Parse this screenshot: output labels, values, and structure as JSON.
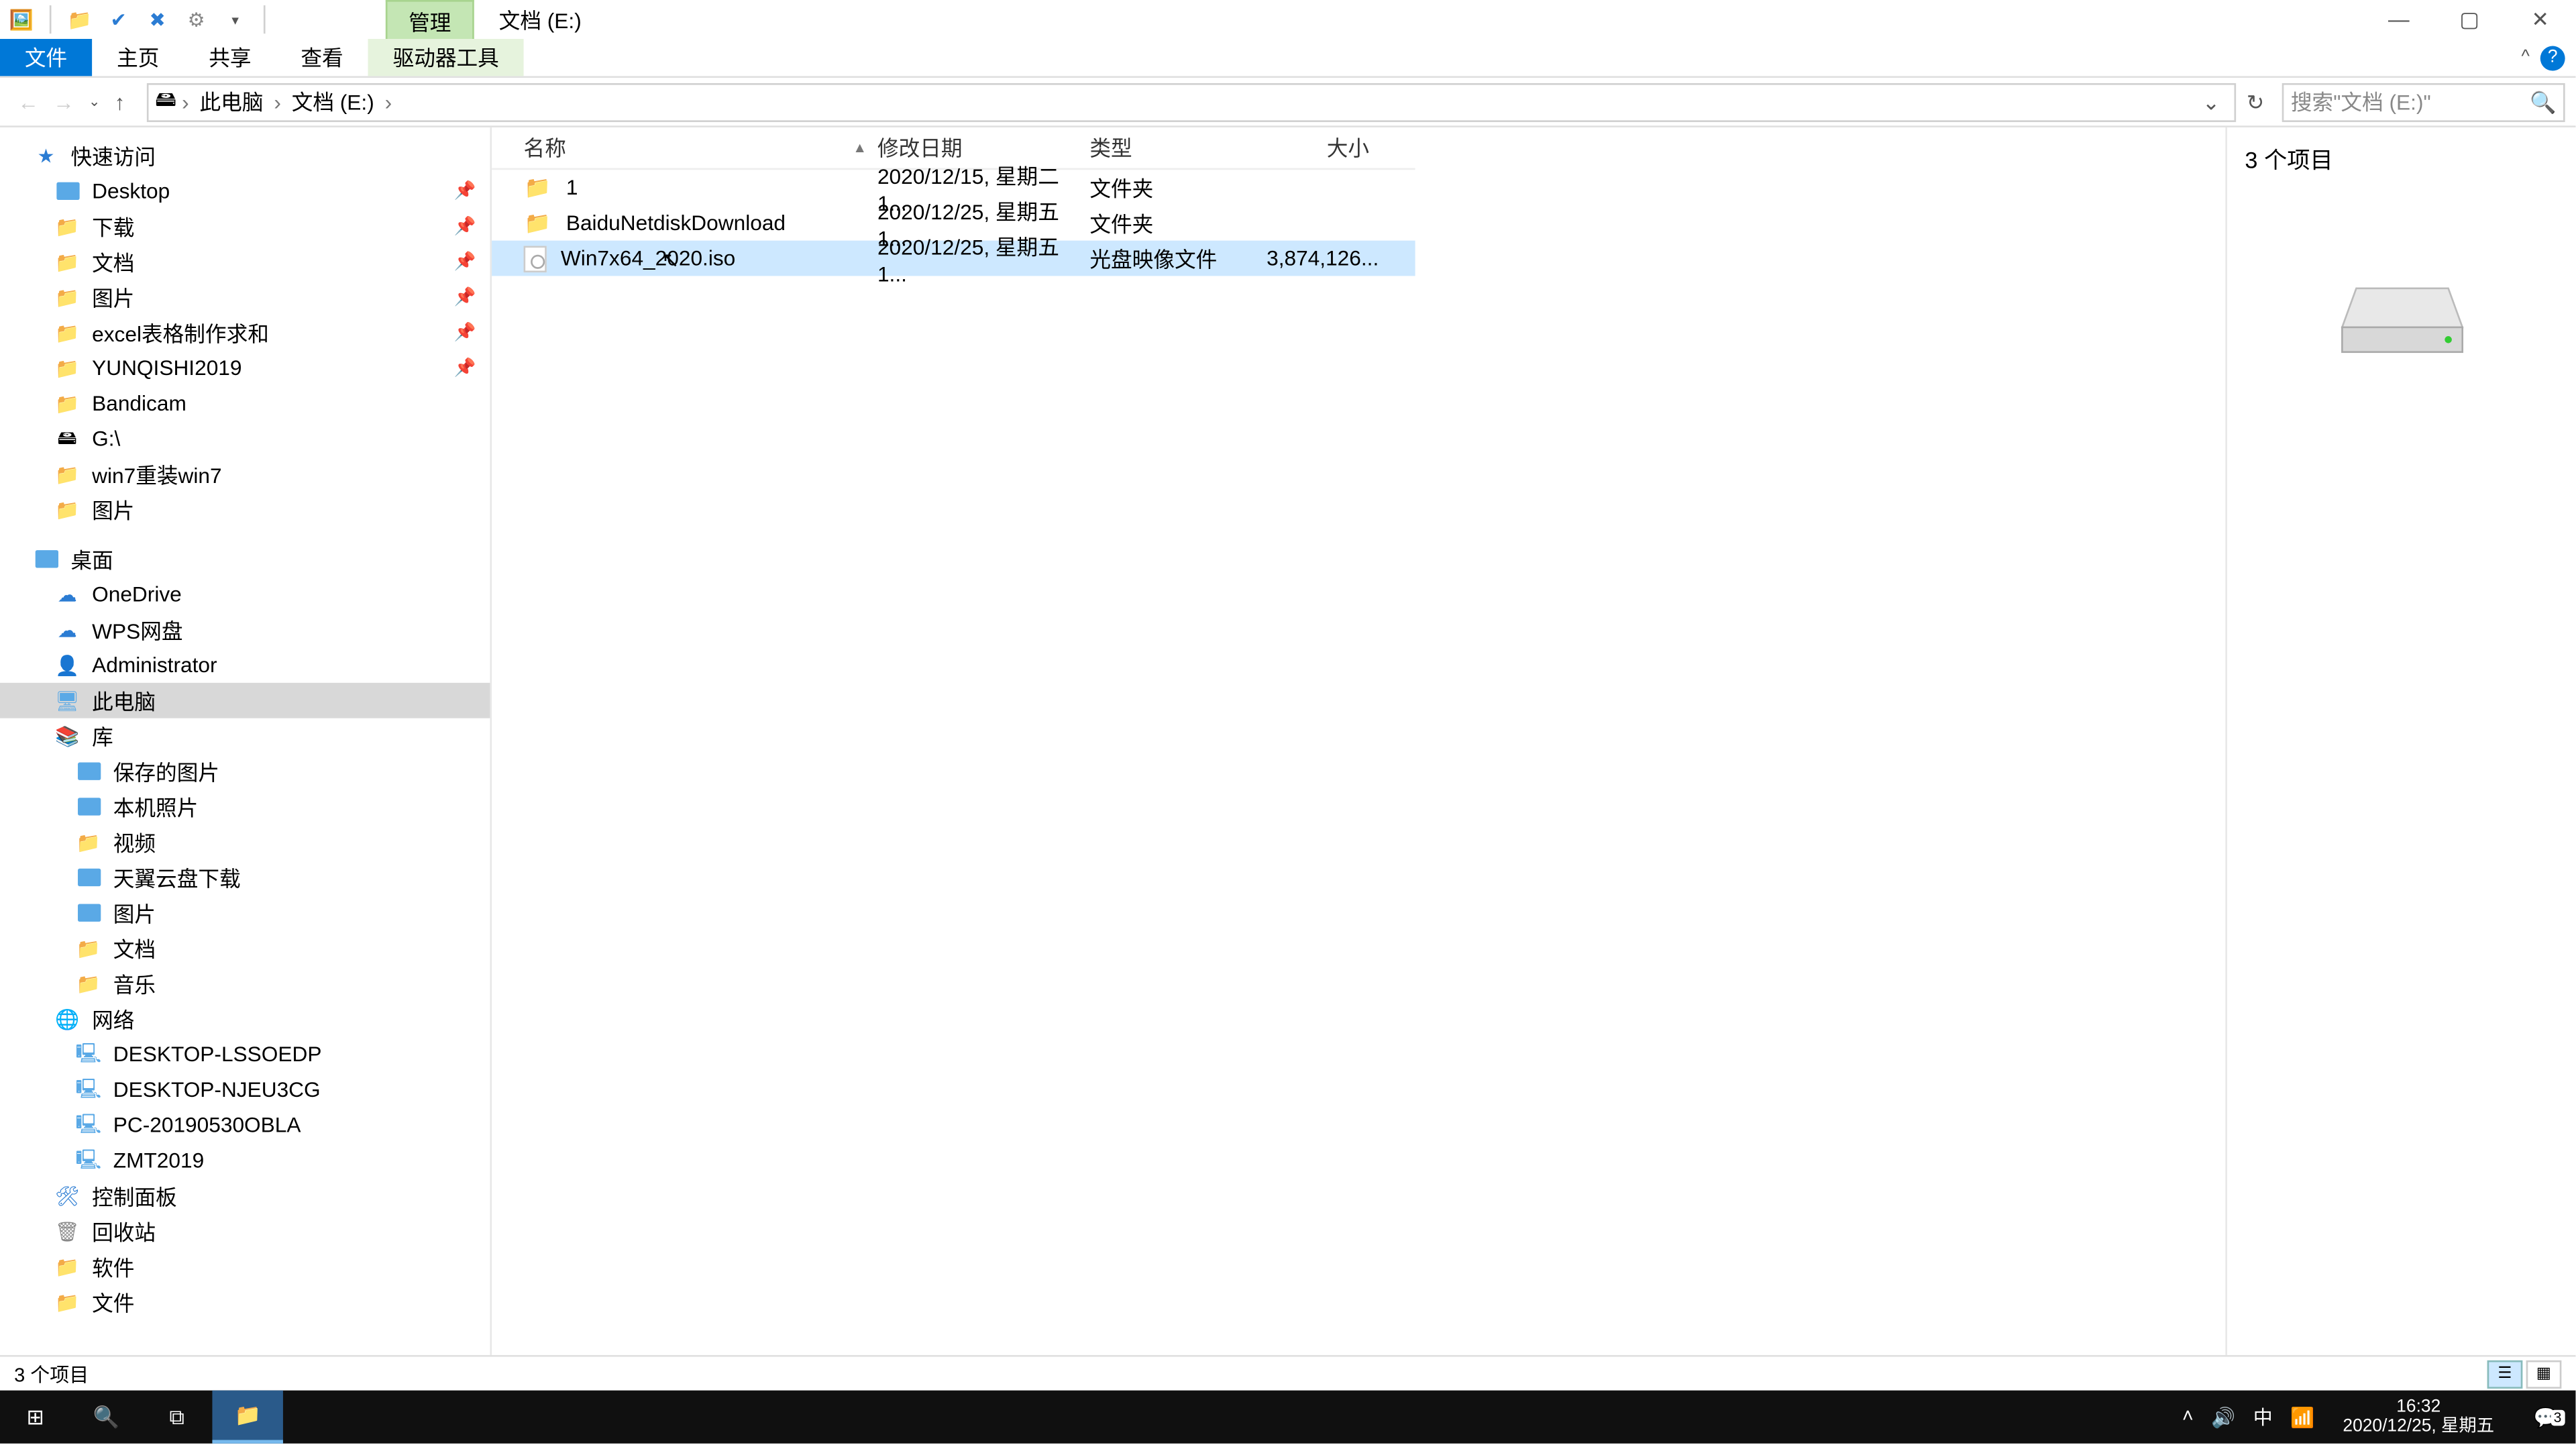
{
  "title": {
    "manage": "管理",
    "drive": "文档 (E:)"
  },
  "winbtns": {
    "min": "—",
    "max": "▢",
    "close": "✕"
  },
  "ribbon": {
    "file": "文件",
    "home": "主页",
    "share": "共享",
    "view": "查看",
    "drivetools": "驱动器工具",
    "expand": "^",
    "help": "?"
  },
  "nav": {
    "back": "←",
    "fwd": "→",
    "recent": "⌄",
    "up": "↑"
  },
  "address": {
    "icon": "🖴",
    "crumbs": [
      "此电脑",
      "文档 (E:)"
    ],
    "sep": "›",
    "dropdown": "⌄",
    "refresh": "↻"
  },
  "search": {
    "placeholder": "搜索\"文档 (E:)\"",
    "icon": "🔍"
  },
  "columns": {
    "name": "名称",
    "date": "修改日期",
    "type": "类型",
    "size": "大小"
  },
  "rows": [
    {
      "icon": "folder",
      "name": "1",
      "date": "2020/12/15, 星期二 1...",
      "type": "文件夹",
      "size": ""
    },
    {
      "icon": "folder",
      "name": "BaiduNetdiskDownload",
      "date": "2020/12/25, 星期五 1...",
      "type": "文件夹",
      "size": ""
    },
    {
      "icon": "iso",
      "name": "Win7x64_2020.iso",
      "date": "2020/12/25, 星期五 1...",
      "type": "光盘映像文件",
      "size": "3,874,126...",
      "selected": true
    }
  ],
  "tree": [
    {
      "l": 1,
      "ico": "star",
      "label": "快速访问"
    },
    {
      "l": 2,
      "ico": "fblue",
      "label": "Desktop",
      "pin": true
    },
    {
      "l": 2,
      "ico": "fyel",
      "label": "下载",
      "pin": true
    },
    {
      "l": 2,
      "ico": "fyel",
      "label": "文档",
      "pin": true
    },
    {
      "l": 2,
      "ico": "fyel",
      "label": "图片",
      "pin": true
    },
    {
      "l": 2,
      "ico": "fyel",
      "label": "excel表格制作求和",
      "pin": true
    },
    {
      "l": 2,
      "ico": "fyel",
      "label": "YUNQISHI2019",
      "pin": true
    },
    {
      "l": 2,
      "ico": "fyel",
      "label": "Bandicam"
    },
    {
      "l": 2,
      "ico": "drv",
      "label": "G:\\"
    },
    {
      "l": 2,
      "ico": "fyel",
      "label": "win7重装win7"
    },
    {
      "l": 2,
      "ico": "fyel",
      "label": "图片"
    },
    {
      "gap": true
    },
    {
      "l": 1,
      "ico": "fblue",
      "label": "桌面"
    },
    {
      "l": 2,
      "ico": "cloud",
      "label": "OneDrive"
    },
    {
      "l": 2,
      "ico": "cloud",
      "label": "WPS网盘"
    },
    {
      "l": 2,
      "ico": "user",
      "label": "Administrator"
    },
    {
      "l": 2,
      "ico": "pc",
      "label": "此电脑",
      "sel": true
    },
    {
      "l": 2,
      "ico": "lib",
      "label": "库"
    },
    {
      "l": 3,
      "ico": "fblue",
      "label": "保存的图片"
    },
    {
      "l": 3,
      "ico": "fblue",
      "label": "本机照片"
    },
    {
      "l": 3,
      "ico": "fyel",
      "label": "视频"
    },
    {
      "l": 3,
      "ico": "fblue",
      "label": "天翼云盘下载"
    },
    {
      "l": 3,
      "ico": "fblue",
      "label": "图片"
    },
    {
      "l": 3,
      "ico": "fyel",
      "label": "文档"
    },
    {
      "l": 3,
      "ico": "fyel",
      "label": "音乐"
    },
    {
      "l": 2,
      "ico": "net",
      "label": "网络"
    },
    {
      "l": 3,
      "ico": "node",
      "label": "DESKTOP-LSSOEDP"
    },
    {
      "l": 3,
      "ico": "node",
      "label": "DESKTOP-NJEU3CG"
    },
    {
      "l": 3,
      "ico": "node",
      "label": "PC-20190530OBLA"
    },
    {
      "l": 3,
      "ico": "node",
      "label": "ZMT2019"
    },
    {
      "l": 2,
      "ico": "cp",
      "label": "控制面板"
    },
    {
      "l": 2,
      "ico": "trash",
      "label": "回收站"
    },
    {
      "l": 2,
      "ico": "fyel",
      "label": "软件"
    },
    {
      "l": 2,
      "ico": "fyel",
      "label": "文件"
    }
  ],
  "preview": {
    "count": "3 个项目"
  },
  "status": {
    "text": "3 个项目"
  },
  "taskbar": {
    "start": "⊞",
    "search": "🔍",
    "taskview": "⧉",
    "explorer": "📁",
    "time": "16:32",
    "date": "2020/12/25, 星期五",
    "ime": "中",
    "notif_count": "3"
  }
}
